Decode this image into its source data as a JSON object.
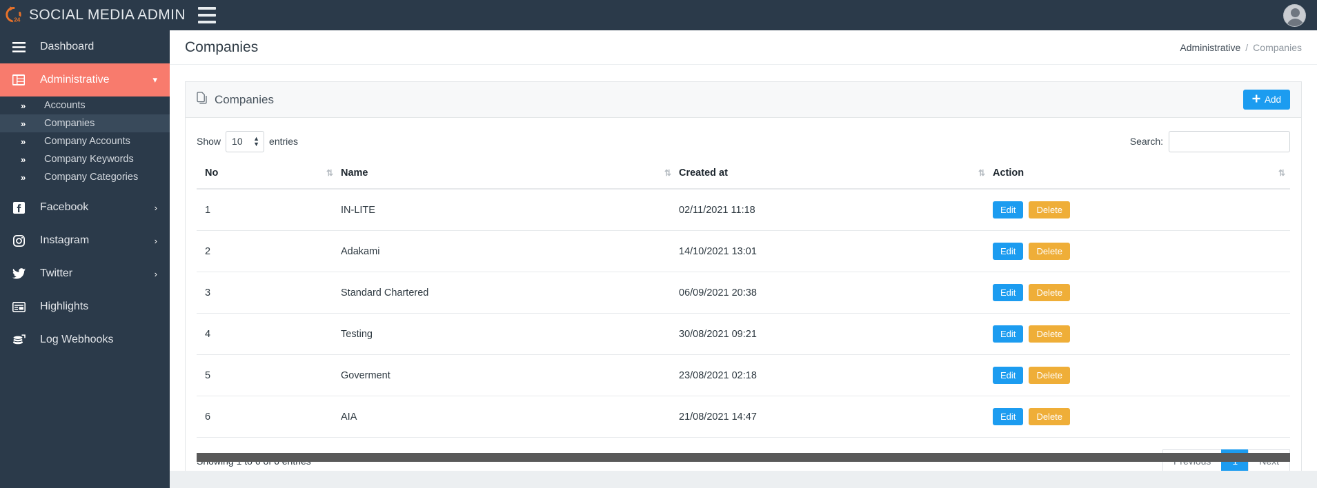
{
  "topbar": {
    "brand_title": "SOCIAL MEDIA ADMIN",
    "logo_icon": "refresh-24-icon",
    "logo_text": "24",
    "menu_toggle_icon": "hamburger-menu-icon",
    "avatar_icon": "user-avatar-icon"
  },
  "sidebar": {
    "items": [
      {
        "label": "Dashboard",
        "icon": "hamburger-icon",
        "active": false,
        "has_chevron": false
      },
      {
        "label": "Administrative",
        "icon": "grid-table-icon",
        "active": true,
        "has_chevron": true,
        "chevron": "▾"
      },
      {
        "label": "Facebook",
        "icon": "facebook-icon",
        "active": false,
        "has_chevron": true,
        "chevron": "›"
      },
      {
        "label": "Instagram",
        "icon": "instagram-icon",
        "active": false,
        "has_chevron": true,
        "chevron": "›"
      },
      {
        "label": "Twitter",
        "icon": "twitter-icon",
        "active": false,
        "has_chevron": true,
        "chevron": "›"
      },
      {
        "label": "Highlights",
        "icon": "list-table-icon",
        "active": false,
        "has_chevron": false
      },
      {
        "label": "Log Webhooks",
        "icon": "database-stack-icon",
        "active": false,
        "has_chevron": false
      }
    ],
    "submenu": [
      {
        "label": "Accounts",
        "active": false
      },
      {
        "label": "Companies",
        "active": true
      },
      {
        "label": "Company Accounts",
        "active": false
      },
      {
        "label": "Company Keywords",
        "active": false
      },
      {
        "label": "Company Categories",
        "active": false
      }
    ]
  },
  "page": {
    "title": "Companies",
    "breadcrumb": {
      "parent": "Administrative",
      "separator": "/",
      "current": "Companies"
    }
  },
  "card": {
    "title": "Companies",
    "title_icon": "copy-files-icon",
    "add_button": {
      "label": "Add",
      "icon": "plus-icon"
    }
  },
  "datatable": {
    "length_label_before": "Show",
    "length_value": "10",
    "length_label_after": "entries",
    "search_label": "Search:",
    "search_value": "",
    "search_placeholder": "",
    "columns": [
      "No",
      "Name",
      "Created at",
      "Action"
    ],
    "sort_icon": "⇅",
    "rows": [
      {
        "no": "1",
        "name": "IN-LITE",
        "created_at": "02/11/2021 11:18"
      },
      {
        "no": "2",
        "name": "Adakami",
        "created_at": "14/10/2021 13:01"
      },
      {
        "no": "3",
        "name": "Standard Chartered",
        "created_at": "06/09/2021 20:38"
      },
      {
        "no": "4",
        "name": "Testing",
        "created_at": "30/08/2021 09:21"
      },
      {
        "no": "5",
        "name": "Goverment",
        "created_at": "23/08/2021 02:18"
      },
      {
        "no": "6",
        "name": "AIA",
        "created_at": "21/08/2021 14:47"
      }
    ],
    "row_actions": {
      "edit_label": "Edit",
      "delete_label": "Delete"
    },
    "info": "Showing 1 to 6 of 6 entries",
    "pagination": {
      "previous": "Previous",
      "pages": [
        "1"
      ],
      "current_page": "1",
      "next": "Next"
    }
  },
  "colors": {
    "sidebar_bg": "#2b3a4a",
    "accent_active": "#f87b6d",
    "primary_blue": "#1c9cf0",
    "warning_orange": "#efae38",
    "logo_orange": "#e8722a"
  }
}
